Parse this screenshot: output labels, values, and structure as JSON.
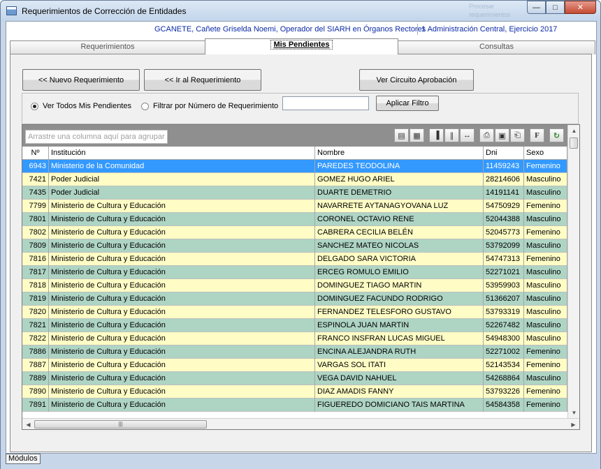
{
  "window": {
    "title": "Requerimientos de Corrección de Entidades",
    "ghost_text": "Procesar requerimientos"
  },
  "userbar": {
    "user": "GCANETE, Cañete Griselda Noemi, Operador del SIARH en Órganos Rectores",
    "context": "1 Administración Central, Ejercicio 2017"
  },
  "tabs": [
    {
      "label": "Requerimientos",
      "active": false
    },
    {
      "label": "Mis Pendientes",
      "active": true
    },
    {
      "label": "Consultas",
      "active": false
    }
  ],
  "actions": {
    "new_req": "<< Nuevo Requerimiento",
    "goto_req": "<< Ir al Requerimiento",
    "circuit": "Ver Circuito Aprobación"
  },
  "filter": {
    "option_all": "Ver Todos Mis Pendientes",
    "option_number": "Filtrar por Número de Requerimiento",
    "input_value": "",
    "apply": "Aplicar Filtro",
    "selected": "all"
  },
  "grid": {
    "group_hint": "Arrastre una columna aquí para agrupar",
    "columns": [
      "Nº",
      "Institución",
      "Nombre",
      "Dni",
      "Sexo"
    ],
    "rows": [
      {
        "n": "6943",
        "inst": "Ministerio de la Comunidad",
        "nombre": "PAREDES TEODOLINA",
        "dni": "11459243",
        "sexo": "Femenino"
      },
      {
        "n": "7421",
        "inst": "Poder Judicial",
        "nombre": "GOMEZ HUGO ARIEL",
        "dni": "28214606",
        "sexo": "Masculino"
      },
      {
        "n": "7435",
        "inst": "Poder Judicial",
        "nombre": "DUARTE DEMETRIO",
        "dni": "14191141",
        "sexo": "Masculino"
      },
      {
        "n": "7799",
        "inst": "Ministerio de Cultura y Educación",
        "nombre": "NAVARRETE AYTANAGYOVANA LUZ",
        "dni": "54750929",
        "sexo": "Femenino"
      },
      {
        "n": "7801",
        "inst": "Ministerio de Cultura y Educación",
        "nombre": "CORONEL OCTAVIO RENE",
        "dni": "52044388",
        "sexo": "Masculino"
      },
      {
        "n": "7802",
        "inst": "Ministerio de Cultura y Educación",
        "nombre": "CABRERA CECILIA BELÉN",
        "dni": "52045773",
        "sexo": "Femenino"
      },
      {
        "n": "7809",
        "inst": "Ministerio de Cultura y Educación",
        "nombre": "SANCHEZ MATEO NICOLAS",
        "dni": "53792099",
        "sexo": "Masculino"
      },
      {
        "n": "7816",
        "inst": "Ministerio de Cultura y Educación",
        "nombre": "DELGADO SARA VICTORIA",
        "dni": "54747313",
        "sexo": "Femenino"
      },
      {
        "n": "7817",
        "inst": "Ministerio de Cultura y Educación",
        "nombre": "ERCEG ROMULO EMILIO",
        "dni": "52271021",
        "sexo": "Masculino"
      },
      {
        "n": "7818",
        "inst": "Ministerio de Cultura y Educación",
        "nombre": "DOMINGUEZ TIAGO MARTIN",
        "dni": "53959903",
        "sexo": "Masculino"
      },
      {
        "n": "7819",
        "inst": "Ministerio de Cultura y Educación",
        "nombre": "DOMINGUEZ FACUNDO RODRIGO",
        "dni": "51366207",
        "sexo": "Masculino"
      },
      {
        "n": "7820",
        "inst": "Ministerio de Cultura y Educación",
        "nombre": "FERNANDEZ TELESFORO GUSTAVO",
        "dni": "53793319",
        "sexo": "Masculino"
      },
      {
        "n": "7821",
        "inst": "Ministerio de Cultura y Educación",
        "nombre": "ESPINOLA JUAN MARTIN",
        "dni": "52267482",
        "sexo": "Masculino"
      },
      {
        "n": "7822",
        "inst": "Ministerio de Cultura y Educación",
        "nombre": "FRANCO INSFRAN LUCAS MIGUEL",
        "dni": "54948300",
        "sexo": "Masculino"
      },
      {
        "n": "7886",
        "inst": "Ministerio de Cultura y Educación",
        "nombre": "ENCINA ALEJANDRA RUTH",
        "dni": "52271002",
        "sexo": "Femenino"
      },
      {
        "n": "7887",
        "inst": "Ministerio de Cultura y Educación",
        "nombre": "VARGAS SOL ITATI",
        "dni": "52143534",
        "sexo": "Femenino"
      },
      {
        "n": "7889",
        "inst": "Ministerio de Cultura y Educación",
        "nombre": "VEGA DAVID NAHUEL",
        "dni": "54268864",
        "sexo": "Masculino"
      },
      {
        "n": "7890",
        "inst": "Ministerio de Cultura y Educación",
        "nombre": "DIAZ AMADIS FANNY",
        "dni": "53793226",
        "sexo": "Femenino"
      },
      {
        "n": "7891",
        "inst": "Ministerio de Cultura y Educación",
        "nombre": "FIGUEREDO DOMICIANO TAIS MARTINA",
        "dni": "54584358",
        "sexo": "Femenino"
      }
    ],
    "selected_row": 0
  },
  "taskbar": {
    "modulos": "Módulos"
  },
  "colors": {
    "row_odd": "#aed4c4",
    "row_even": "#fffdc5",
    "selected": "#3399ff",
    "user_text": "#0b2aa6"
  }
}
